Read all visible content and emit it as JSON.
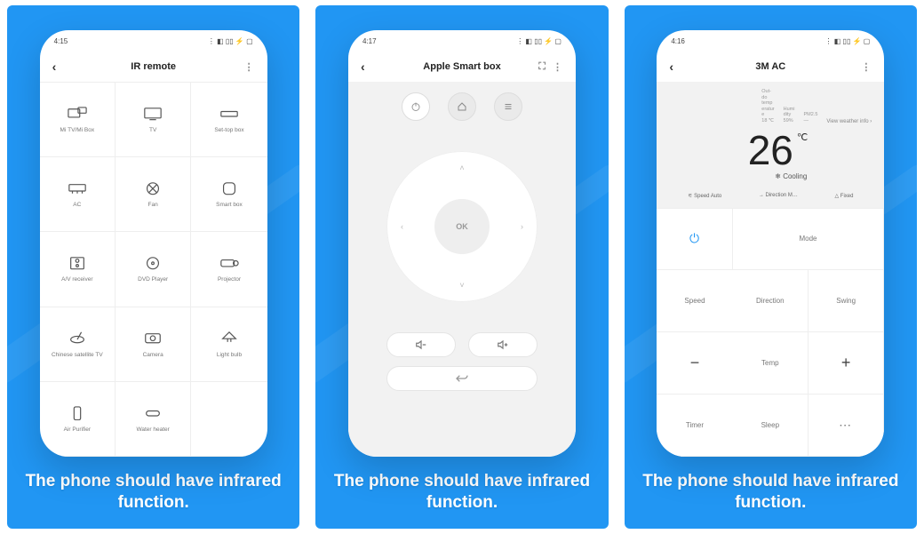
{
  "caption": "The phone should have infrared function.",
  "status_icons": "⋮ ◧ ▯▯ ⚡ ▢",
  "panel1": {
    "time": "4:15",
    "title": "IR remote",
    "devices": [
      "Mi TV/Mi Box",
      "TV",
      "Set-top box",
      "AC",
      "Fan",
      "Smart box",
      "A/V receiver",
      "DVD Player",
      "Projector",
      "Chinese satellite TV",
      "Camera",
      "Light bulb",
      "Air Purifier",
      "Water heater"
    ]
  },
  "panel2": {
    "time": "4:17",
    "title": "Apple Smart box",
    "ok": "OK"
  },
  "panel3": {
    "time": "4:16",
    "title": "3M AC",
    "weather": {
      "outdoor_label": "Out-\ndo\ntemp\neratur\ne",
      "outdoor_val": "18 ℃",
      "humidity_label": "Humi\ndity",
      "humidity_val": "59%",
      "pm_label": "PM2.5",
      "pm_val": "—",
      "link": "View weather info  ›"
    },
    "temp": "26",
    "unit": "℃",
    "state_icon": "❄",
    "state": "Cooling",
    "modes": {
      "speed": "Speed Auto",
      "direction": "Direction M…",
      "swing": "Fixed"
    },
    "controls": {
      "mode": "Mode",
      "speed": "Speed",
      "direction": "Direction",
      "swing": "Swing",
      "temp": "Temp",
      "timer": "Timer",
      "sleep": "Sleep"
    }
  }
}
